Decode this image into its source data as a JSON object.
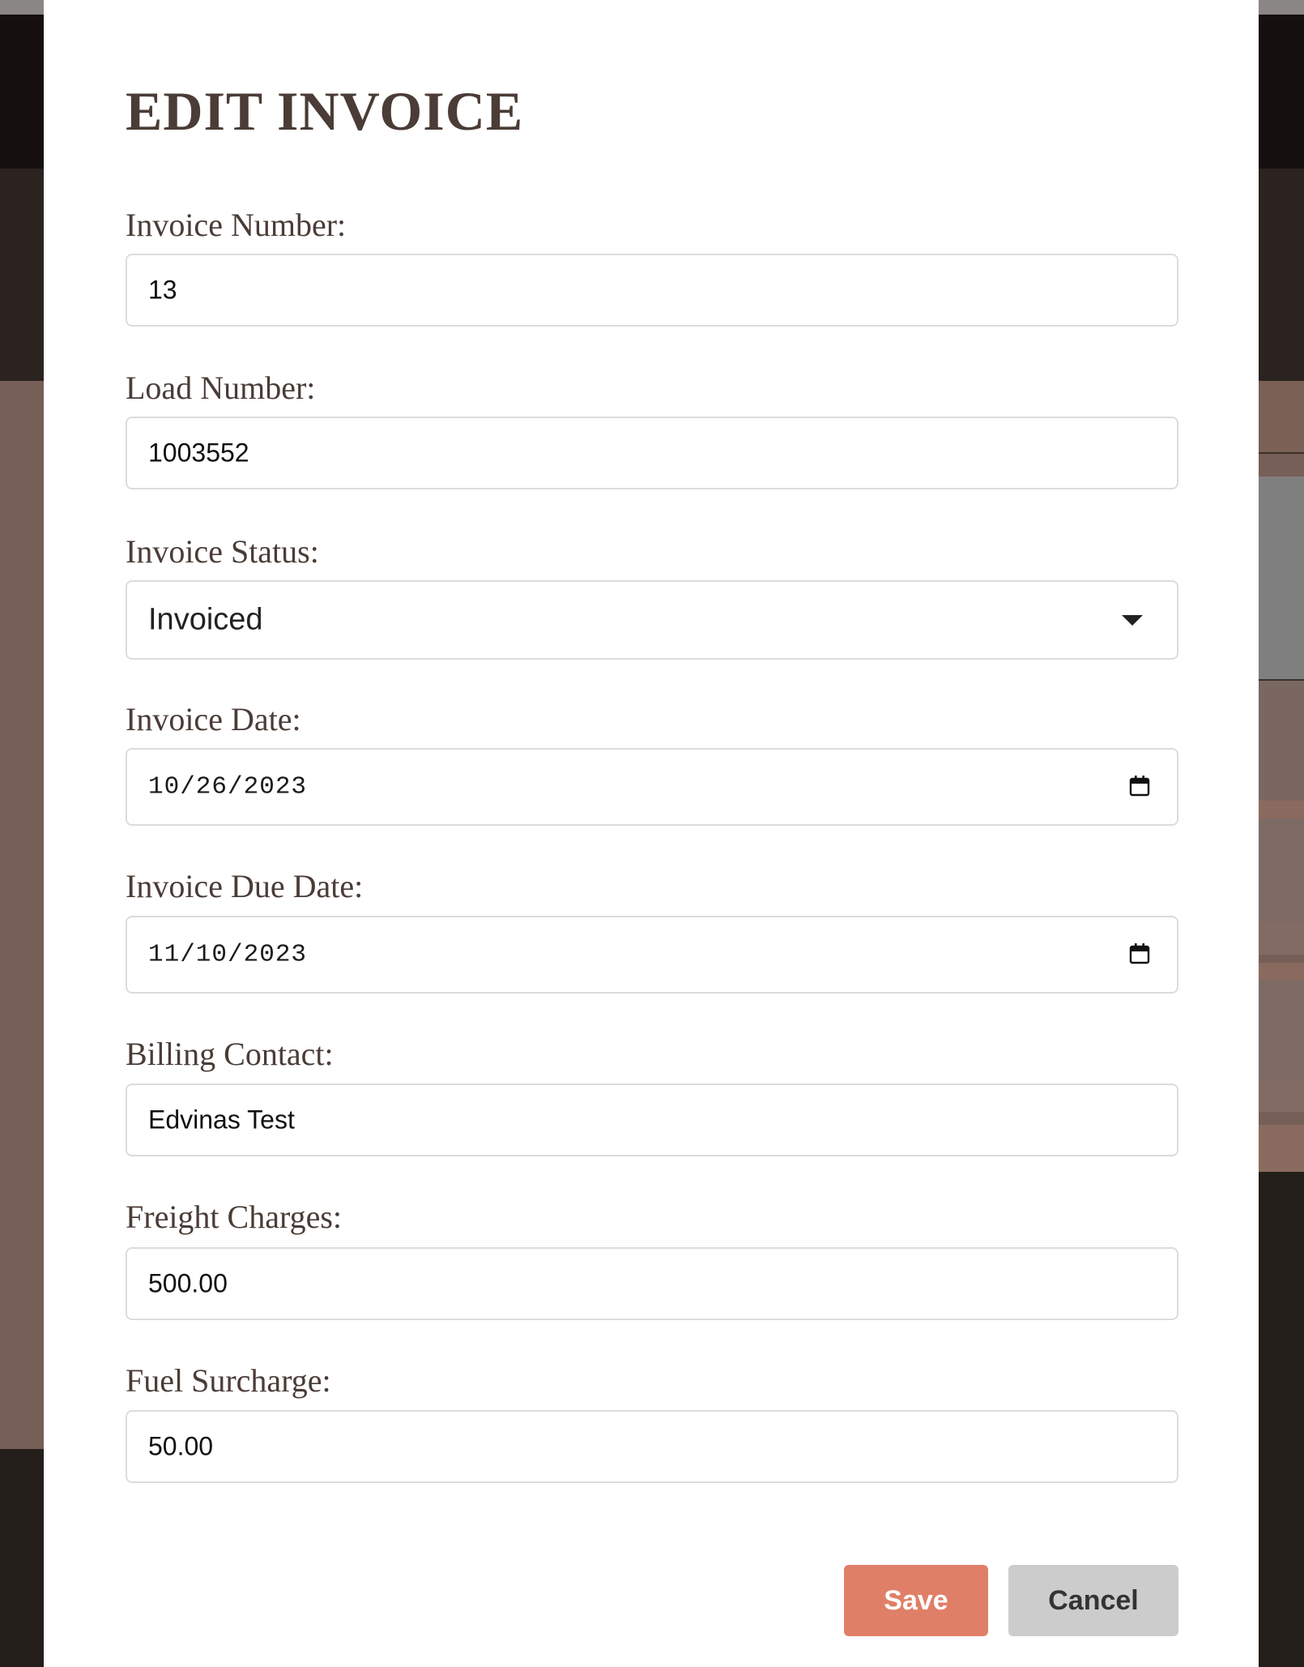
{
  "modal": {
    "title": "EDIT INVOICE",
    "fields": [
      {
        "label": "Invoice Number:",
        "value": "13"
      },
      {
        "label": "Load Number:",
        "value": "1003552"
      },
      {
        "label": "Invoice Status:",
        "value": "Invoiced"
      },
      {
        "label": "Invoice Date:",
        "value": "10/26/2023"
      },
      {
        "label": "Invoice Due Date:",
        "value": "11/10/2023"
      },
      {
        "label": "Billing Contact:",
        "value": "Edvinas Test"
      },
      {
        "label": "Freight Charges:",
        "value": "500.00"
      },
      {
        "label": "Fuel Surcharge:",
        "value": "50.00"
      }
    ],
    "buttons": {
      "save": "Save",
      "cancel": "Cancel"
    }
  },
  "icons": {
    "status_dropdown": "chevron-down-icon",
    "invoice_date_picker": "calendar-icon",
    "due_date_picker": "calendar-icon"
  },
  "colors": {
    "save_button": "#e07f68",
    "cancel_button": "#cccccc",
    "heading_text": "#4a3c36",
    "backdrop": "#765f56"
  }
}
